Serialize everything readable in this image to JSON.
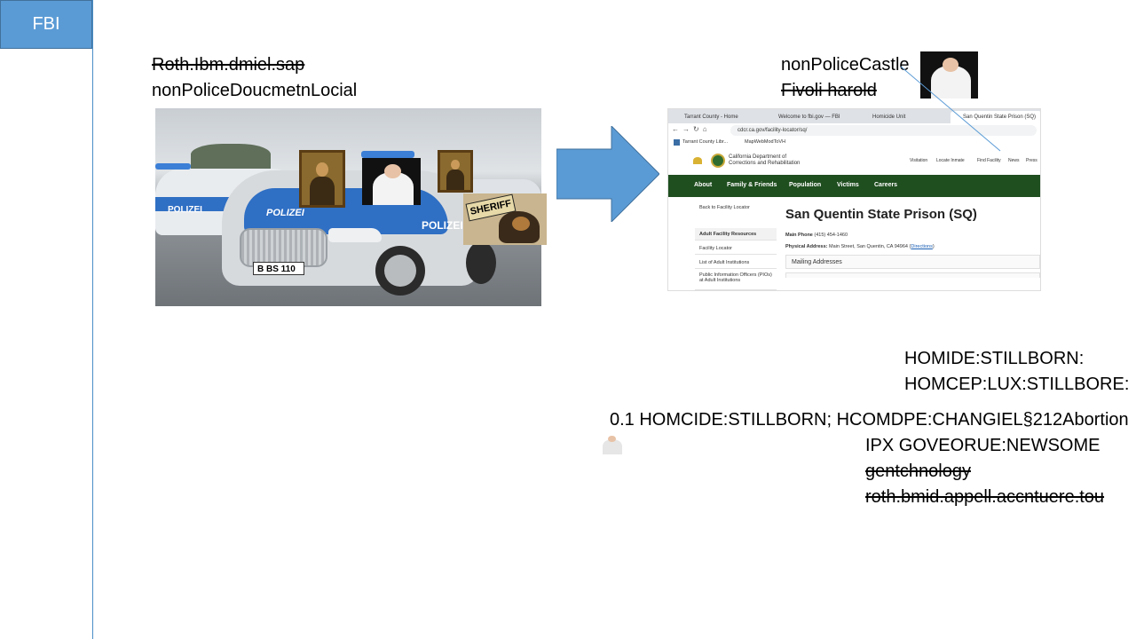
{
  "sidebar": {
    "tab_label": "FBI"
  },
  "left_caption": {
    "line1": "Roth.Ibm.dmiel.sap",
    "line2": "nonPoliceDoucmetnLocial"
  },
  "left_photo": {
    "plate": "B BS 110",
    "door_text": "POLIZEI",
    "hood_text": "POLIZEI",
    "rear_car_text": "POLIZEI",
    "badge": "SHERIFF"
  },
  "right_caption": {
    "line1": "nonPoliceCastle",
    "line2": "Fivoli harold"
  },
  "browser": {
    "tabs": [
      "Tarrant County - Home",
      "Welcome to fbi.gov — FBI",
      "Homicide Unit",
      "San Quentin State Prison (SQ)"
    ],
    "url": "cdcr.ca.gov/facility-locator/sq/",
    "bookmarks": [
      "Tarrant County Libr...",
      "MapWebModToVH"
    ],
    "site_name_line1": "California Department of",
    "site_name_line2": "Corrections and Rehabilitation",
    "top_links": [
      "Visitation",
      "Locate Inmate",
      "Find Facility",
      "News",
      "Press"
    ],
    "nav": [
      "About",
      "Family & Friends",
      "Population",
      "Victims",
      "Careers"
    ],
    "back_link": "Back to Facility Locator",
    "left_nav": [
      "Adult Facility Resources",
      "Facility Locator",
      "List of Adult Institutions",
      "Public Information Officers (PIOs) at Adult Institutions"
    ],
    "page_title": "San Quentin State Prison (SQ)",
    "phone_label": "Main Phone",
    "phone": "(415) 454-1460",
    "address_label": "Physical Address:",
    "address": "Main Street, San Quentin, CA 94964",
    "directions": "Directions",
    "mailing": "Mailing Addresses"
  },
  "notes": {
    "n1": "HOMIDE:STILLBORN:",
    "n2": "HOMCEP:LUX:STILLBORE:",
    "n3": "0.1 HOMCIDE:STILLBORN; HCOMDPE:CHANGIEL§212Abortion",
    "n4": "IPX GOVEORUE:NEWSOME",
    "n5": "gentchnology",
    "n6": "roth.bmid.appell.accntuere.tou"
  },
  "colors": {
    "sidebar_tab": "#5b9bd5",
    "arrow": "#5b9bd5",
    "site_nav": "#1f4e1f"
  }
}
